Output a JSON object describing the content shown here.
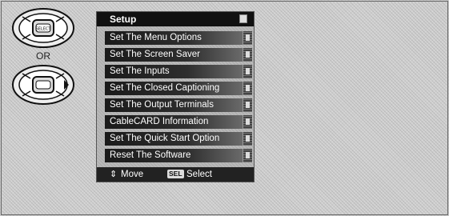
{
  "divider_text": "OR",
  "remote_top": {
    "center_button_label": "SELECT"
  },
  "menu": {
    "title": "Setup",
    "items": [
      {
        "label": "Set The Menu Options"
      },
      {
        "label": "Set The Screen Saver"
      },
      {
        "label": "Set The Inputs"
      },
      {
        "label": "Set The Closed Captioning"
      },
      {
        "label": "Set The Output Terminals"
      },
      {
        "label": "CableCARD Information"
      },
      {
        "label": "Set The Quick Start Option"
      },
      {
        "label": "Reset The Software"
      }
    ],
    "footer": {
      "move_icon": "updown-arrows-icon",
      "move_label": "Move",
      "select_icon_text": "SEL",
      "select_label": "Select"
    }
  }
}
